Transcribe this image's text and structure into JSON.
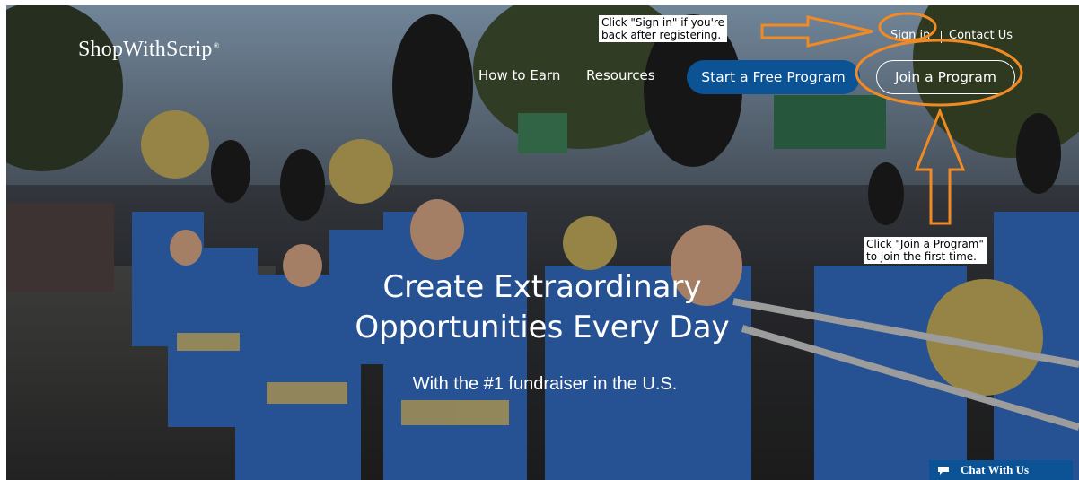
{
  "header": {
    "logo": "ShopWithScrip",
    "logo_mark": "®",
    "sign_in": "Sign in",
    "contact_us": "Contact Us",
    "nav": [
      "How to Earn",
      "Resources"
    ],
    "start_button": "Start a Free Program",
    "join_button": "Join a Program"
  },
  "hero": {
    "headline_line1": "Create Extraordinary",
    "headline_line2": "Opportunities Every Day",
    "subheadline": "With the #1 fundraiser in the U.S."
  },
  "annotations": {
    "signin_note": [
      "Click \"Sign in\" if you're",
      "back after registering."
    ],
    "join_note": [
      "Click \"Join a Program\"",
      "to join the first time."
    ],
    "annotation_color": "#f08a24"
  },
  "chat": {
    "label": "Chat With Us",
    "icon": "chat-bubble-icon"
  }
}
